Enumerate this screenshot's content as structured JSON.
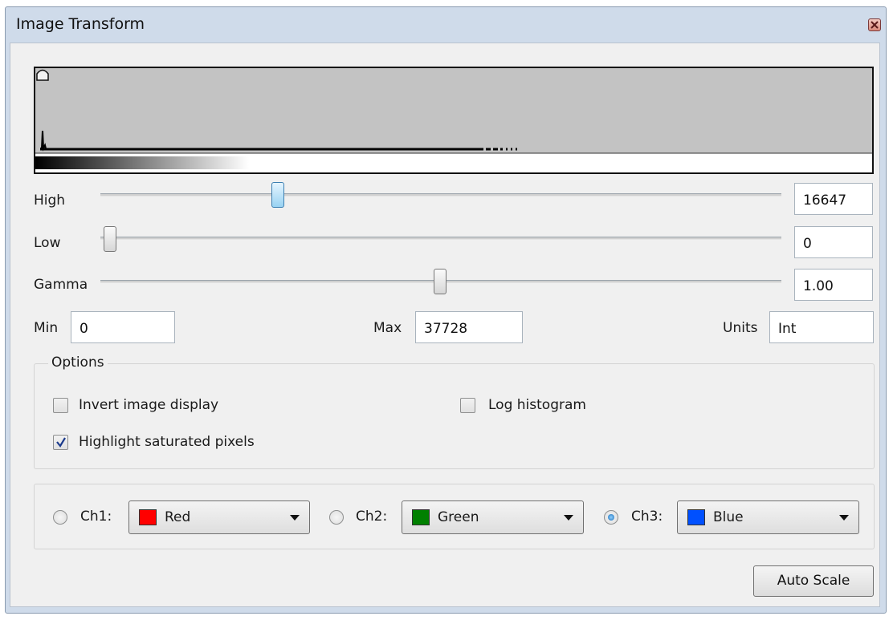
{
  "window": {
    "title": "Image Transform"
  },
  "sliders": {
    "high": {
      "label": "High",
      "value": "16647",
      "position_pct": 18.5
    },
    "low": {
      "label": "Low",
      "value": "0",
      "position_pct": 0
    },
    "gamma": {
      "label": "Gamma",
      "value": "1.00",
      "position_pct": 49
    }
  },
  "range": {
    "min_label": "Min",
    "min_value": "0",
    "max_label": "Max",
    "max_value": "37728",
    "units_label": "Units",
    "units_value": "Int"
  },
  "options": {
    "legend": "Options",
    "invert_label": "Invert image display",
    "invert_checked": false,
    "log_label": "Log histogram",
    "log_checked": false,
    "highlight_label": "Highlight saturated pixels",
    "highlight_checked": true
  },
  "channels": [
    {
      "label": "Ch1:",
      "color_name": "Red",
      "color": "#ff0000",
      "selected": false
    },
    {
      "label": "Ch2:",
      "color_name": "Green",
      "color": "#008000",
      "selected": false
    },
    {
      "label": "Ch3:",
      "color_name": "Blue",
      "color": "#0050ff",
      "selected": true
    }
  ],
  "buttons": {
    "auto_scale": "Auto Scale"
  },
  "colors": {
    "histogram_bg": "#c3c3c3",
    "slider_active": "#98d2f2"
  }
}
